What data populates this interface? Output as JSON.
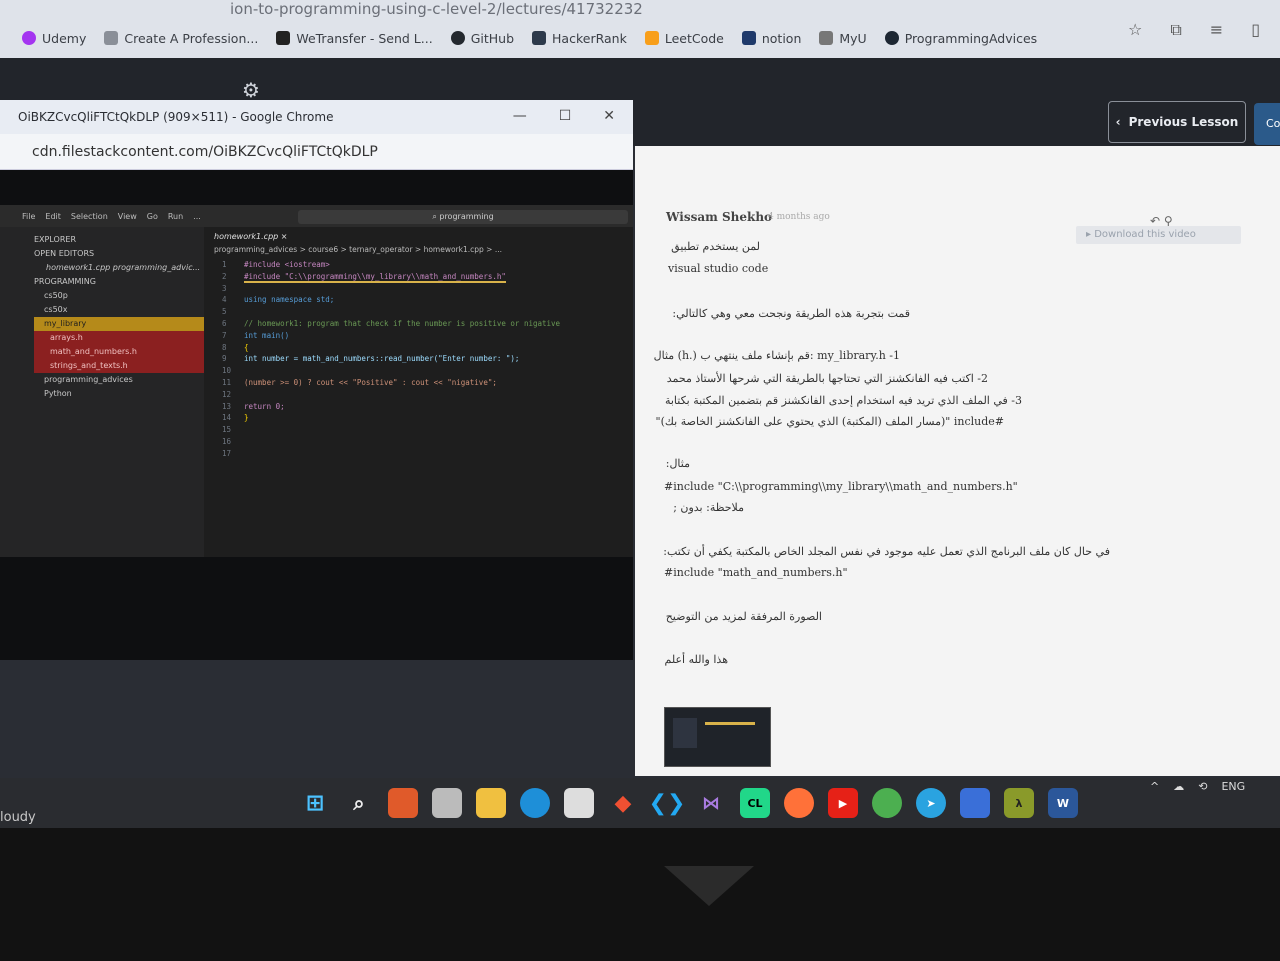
{
  "browser": {
    "url_fragment": "ion-to-programming-using-c-level-2/lectures/41732232",
    "bookmarks": [
      "Udemy",
      "Create A Profession...",
      "WeTransfer - Send L...",
      "GitHub",
      "HackerRank",
      "LeetCode",
      "notion",
      "MyU",
      "ProgrammingAdvices"
    ]
  },
  "course": {
    "previous_label": "Previous Lesson",
    "next_label": "Co"
  },
  "popup": {
    "title": "OiBKZCvcQliFTCtQkDLP (909×511) - Google Chrome",
    "url": "cdn.filestackcontent.com/OiBKZCvcQliFTCtQkDLP"
  },
  "vscode": {
    "menu": [
      "File",
      "Edit",
      "Selection",
      "View",
      "Go",
      "Run",
      "..."
    ],
    "search": "programming",
    "explorer_title": "EXPLORER",
    "open_editors": "OPEN EDITORS",
    "open_file": "homework1.cpp programming_advic...",
    "programming_label": "PROGRAMMING",
    "tree": [
      "cs50p",
      "cs50x",
      "my_library",
      "arrays.h",
      "math_and_numbers.h",
      "strings_and_texts.h",
      "programming_advices",
      "Python"
    ],
    "tab": "homework1.cpp",
    "breadcrumbs": "programming_advices > course6 > ternary_operator > homework1.cpp > ...",
    "code": [
      "#include <iostream>",
      "#include \"C:\\\\programming\\\\my_library\\\\math_and_numbers.h\"",
      "",
      "using namespace std;",
      "",
      "// homework1: program that check if the number is positive or nigative",
      "int main()",
      "{",
      "    int number = math_and_numbers::read_number(\"Enter number: \");",
      "",
      "    (number >= 0) ? cout << \"Positive\" : cout << \"nigative\";",
      "",
      "    return 0;",
      "}",
      "",
      "",
      ""
    ]
  },
  "comment": {
    "author": "Wissam Shekho",
    "time": "4 months ago",
    "download_label": "Download this video",
    "lines": [
      "لمن يستخدم تطبيق",
      "visual studio code",
      "قمت بتجربة هذه الطريقة ونجحت معي وهي كالتالي:",
      "1- my_library.h :قم بإنشاء ملف ينتهي ب (.h) مثال",
      "2- اكتب فيه الفانكشنز التي تحتاجها بالطريقة التي شرحها الأستاذ محمد",
      "3- في الملف الذي تريد فيه استخدام إحدى الفانكشنز قم بتضمين المكتبة بكتابة",
      "#include \"(مسار الملف (المكتبة) الذي يحتوي على الفانكشنز الخاصة بك)\"",
      "مثال:",
      "#include \"C:\\\\programming\\\\my_library\\\\math_and_numbers.h\"",
      "ملاحظة: بدون ;",
      "في حال كان ملف البرنامج الذي تعمل عليه موجود في نفس المجلد الخاص بالمكتبة يكفي أن تكتب:",
      "#include \"math_and_numbers.h\"",
      "الصورة المرفقة لمزيد من التوضيح",
      "هذا والله أعلم"
    ]
  },
  "desktop": {
    "weather": "loudy",
    "tray_lang": "ENG"
  },
  "colors": {
    "accent_blue": "#2b5a8a",
    "vscode_bg": "#1e1e1e",
    "folder_highlight": "#b58a1a",
    "error_file": "#8b2020"
  }
}
